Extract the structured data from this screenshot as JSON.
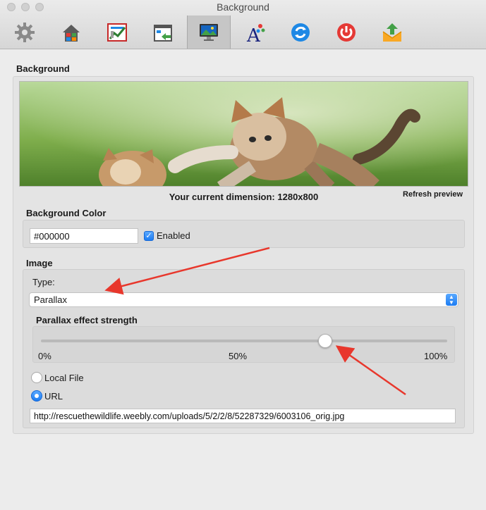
{
  "window": {
    "title": "Background"
  },
  "toolbar": {
    "items": [
      {
        "icon": "gear-icon"
      },
      {
        "icon": "home-icon"
      },
      {
        "icon": "chart-icon"
      },
      {
        "icon": "layout-icon"
      },
      {
        "icon": "monitor-icon",
        "active": true
      },
      {
        "icon": "font-icon"
      },
      {
        "icon": "refresh-icon"
      },
      {
        "icon": "power-icon"
      },
      {
        "icon": "export-icon"
      }
    ]
  },
  "background": {
    "title": "Background",
    "dimension_text": "Your current dimension: 1280x800",
    "refresh_label": "Refresh preview"
  },
  "background_color": {
    "title": "Background Color",
    "value": "#000000",
    "enabled_label": "Enabled",
    "enabled": true
  },
  "image": {
    "title": "Image",
    "type_label": "Type:",
    "type_value": "Parallax",
    "parallax": {
      "title": "Parallax effect strength",
      "ticks": [
        "0%",
        "50%",
        "100%"
      ],
      "value_percent": 70
    },
    "source_options": [
      {
        "label": "Local File",
        "selected": false
      },
      {
        "label": "URL",
        "selected": true
      }
    ],
    "url": "http://rescuethewildlife.weebly.com/uploads/5/2/2/8/52287329/6003106_orig.jpg"
  },
  "colors": {
    "accent": "#1d7cf2",
    "annotation_arrow": "#e8372c"
  }
}
